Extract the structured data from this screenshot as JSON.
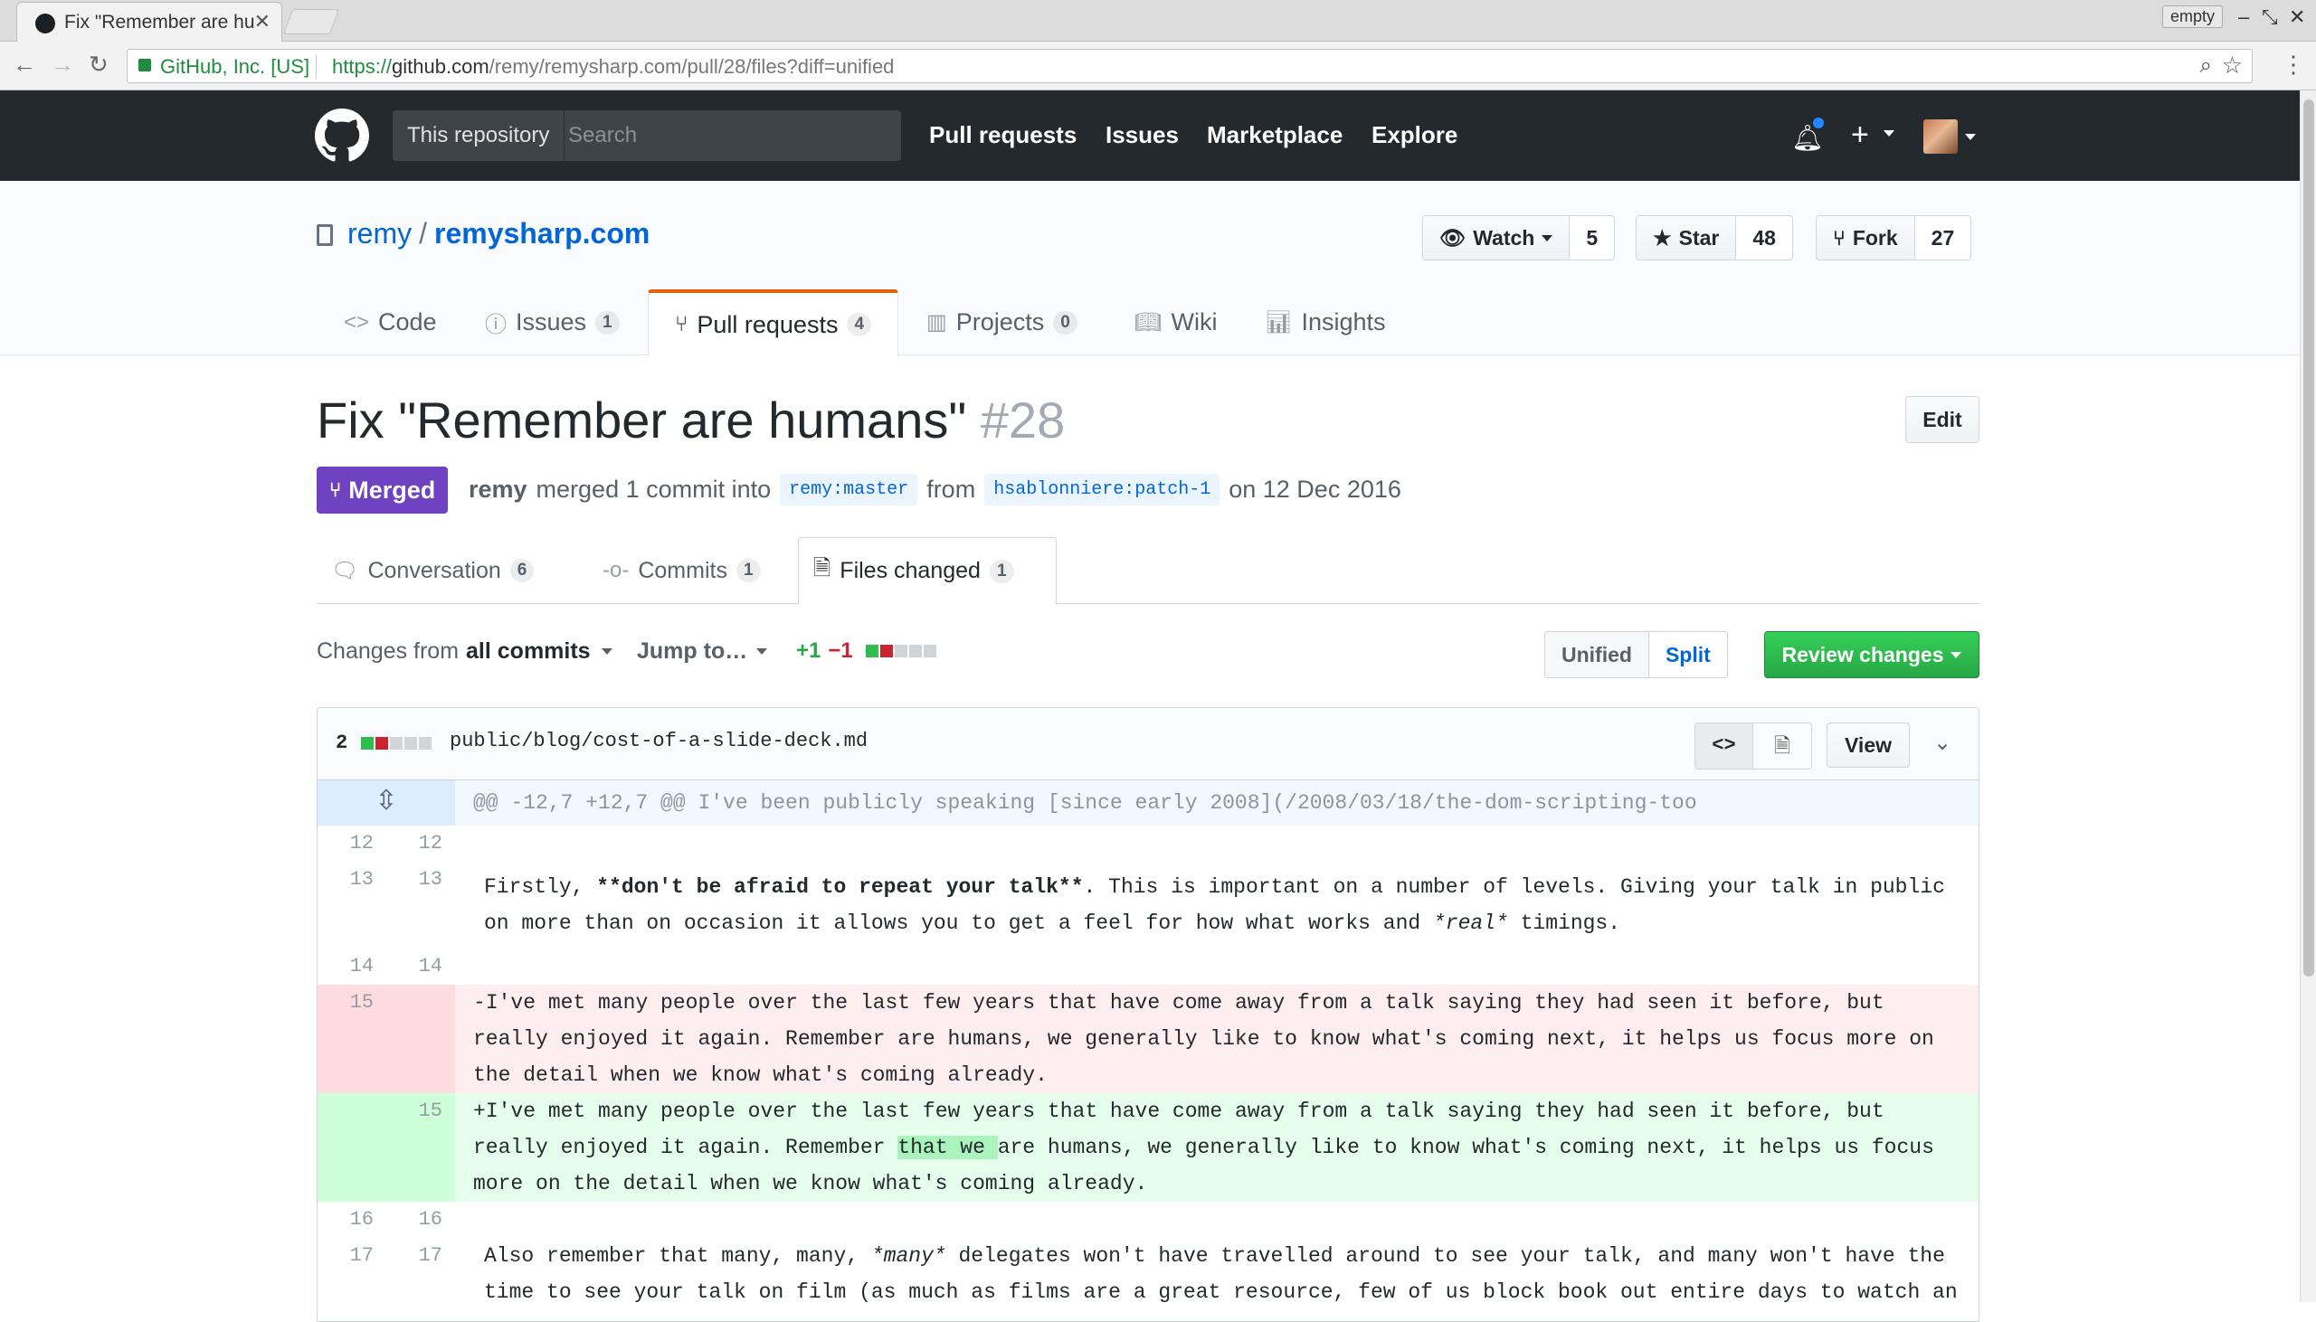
{
  "browser": {
    "tab_title": "Fix \"Remember are hu",
    "profile_label": "empty",
    "site_identity": "GitHub, Inc. [US]",
    "url_scheme": "https://",
    "url_host": "github.com",
    "url_path": "/remy/remysharp.com/pull/28/files?diff=unified",
    "accent_secure": "#1e8e3e"
  },
  "header": {
    "scope_label": "This repository",
    "search_placeholder": "Search",
    "nav": [
      "Pull requests",
      "Issues",
      "Marketplace",
      "Explore"
    ],
    "plus_label": "+"
  },
  "repo": {
    "owner": "remy",
    "separator": "/",
    "name": "remysharp.com",
    "watch_label": "Watch",
    "watch_count": "5",
    "star_label": "Star",
    "star_count": "48",
    "fork_label": "Fork",
    "fork_count": "27",
    "tabs": [
      {
        "label": "Code",
        "count": null
      },
      {
        "label": "Issues",
        "count": "1"
      },
      {
        "label": "Pull requests",
        "count": "4"
      },
      {
        "label": "Projects",
        "count": "0"
      },
      {
        "label": "Wiki",
        "count": null
      },
      {
        "label": "Insights",
        "count": null
      }
    ]
  },
  "pr": {
    "title": "Fix \"Remember are humans\"",
    "number": "#28",
    "edit_label": "Edit",
    "status": "Merged",
    "status_color": "#6f42c1",
    "author": "remy",
    "merged_text": "merged 1 commit into",
    "base_branch": "remy:master",
    "from_text": "from",
    "head_branch": "hsablonniere:patch-1",
    "date_text": "on 12 Dec 2016",
    "tabs": [
      {
        "label": "Conversation",
        "count": "6"
      },
      {
        "label": "Commits",
        "count": "1"
      },
      {
        "label": "Files changed",
        "count": "1"
      }
    ]
  },
  "toolbar": {
    "changes_from_prefix": "Changes from",
    "changes_from_value": "all commits",
    "jump_to": "Jump to…",
    "additions": "+1",
    "deletions": "−1",
    "unified_label": "Unified",
    "split_label": "Split",
    "review_label": "Review changes"
  },
  "file": {
    "change_count": "2",
    "path": "public/blog/cost-of-a-slide-deck.md",
    "view_label": "View",
    "hunk_header": "@@ -12,7 +12,7 @@ I've been publicly speaking [since early 2008](/2008/03/18/the-dom-scripting-too",
    "lines": [
      {
        "type": "ctx",
        "old": "12",
        "new": "12",
        "text": ""
      },
      {
        "type": "ctx",
        "old": "13",
        "new": "13",
        "pre": "Firstly, ",
        "bold": "**don't be afraid to repeat your talk**",
        "post": ". This is important on a number of levels. Giving your talk in public on more than on occasion it allows you to get a feel for how what works and ",
        "italic": "*real*",
        "tail": " timings."
      },
      {
        "type": "ctx",
        "old": "14",
        "new": "14",
        "text": ""
      },
      {
        "type": "del",
        "old": "15",
        "new": "",
        "marker": "-",
        "text": "I've met many people over the last few years that have come away from a talk saying they had seen it before, but really enjoyed it again. Remember are humans, we generally like to know what's coming next, it helps us focus more on the detail when we know what's coming already."
      },
      {
        "type": "add",
        "old": "",
        "new": "15",
        "marker": "+",
        "pre": "I've met many people over the last few years that have come away from a talk saying they had seen it before, but really enjoyed it again. Remember ",
        "highlight": "that we ",
        "post": "are humans, we generally like to know what's coming next, it helps us focus more on the detail when we know what's coming already."
      },
      {
        "type": "ctx",
        "old": "16",
        "new": "16",
        "text": ""
      },
      {
        "type": "ctx",
        "old": "17",
        "new": "17",
        "pre": "Also remember that many, many, ",
        "italic": "*many*",
        "post": " delegates won't have travelled around to see your talk, and many won't have the time to see your talk on film (as much as films are a great resource, few of us block book out entire days to watch an"
      }
    ]
  }
}
